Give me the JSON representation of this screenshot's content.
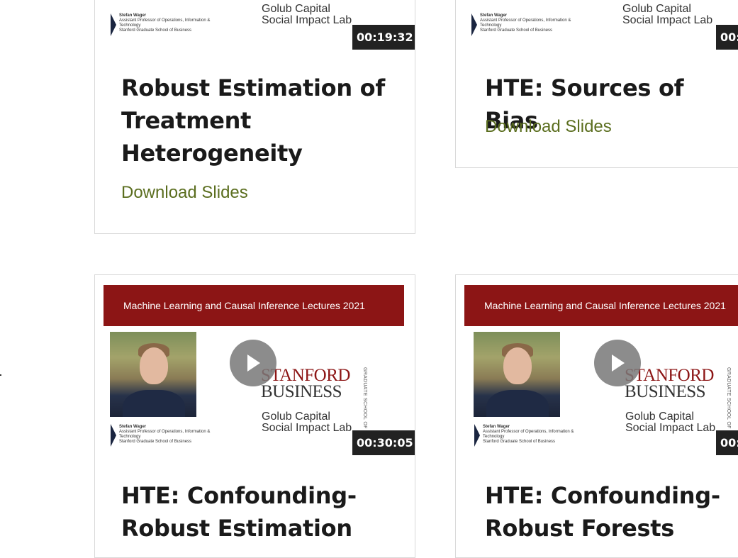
{
  "cards": [
    {
      "thumb_caption": {
        "name": "Stefan Wager",
        "role": "Assistant Professor of Operations, Information & Technology",
        "school": "Stanford Graduate School of Business"
      },
      "thumb_lab": [
        "Golub Capital",
        "Social Impact Lab"
      ],
      "duration": "00:19:32",
      "title": "Robust Estimation of Treatment Heterogeneity",
      "download_label": "Download Slides"
    },
    {
      "thumb_caption": {
        "name": "Stefan Wager",
        "role": "Assistant Professor of Operations, Information & Technology",
        "school": "Stanford Graduate School of Business"
      },
      "thumb_lab": [
        "Golub Capital",
        "Social Impact Lab"
      ],
      "duration": "00:",
      "title": "HTE: Sources of Bias",
      "download_label": "Download Slides"
    },
    {
      "thumb_banner": "Machine Learning and Causal Inference Lectures 2021",
      "thumb_logo": {
        "stanford": "STANFORD",
        "business": "BUSINESS",
        "graduate": "GRADUATE SCHOOL OF"
      },
      "thumb_caption": {
        "name": "Stefan Wager",
        "role": "Assistant Professor of Operations, Information & Technology",
        "school": "Stanford Graduate School of Business"
      },
      "thumb_lab": [
        "Golub Capital",
        "Social Impact Lab"
      ],
      "duration": "00:30:05",
      "title": "HTE: Confounding-Robust Estimation"
    },
    {
      "thumb_banner": "Machine Learning and Causal Inference Lectures 2021",
      "thumb_logo": {
        "stanford": "STANFORD",
        "business": "BUSINESS",
        "graduate": "GRADUATE SCHOOL OF"
      },
      "thumb_caption": {
        "name": "Stefan Wager",
        "role": "Assistant Professor of Operations, Information & Technology",
        "school": "Stanford Graduate School of Business"
      },
      "thumb_lab": [
        "Golub Capital",
        "Social Impact Lab"
      ],
      "duration": "00:",
      "title": "HTE: Confounding-Robust Forests"
    }
  ],
  "colors": {
    "accent": "#8c1515",
    "link": "#5b6e1f",
    "duration_bg": "#222222"
  }
}
